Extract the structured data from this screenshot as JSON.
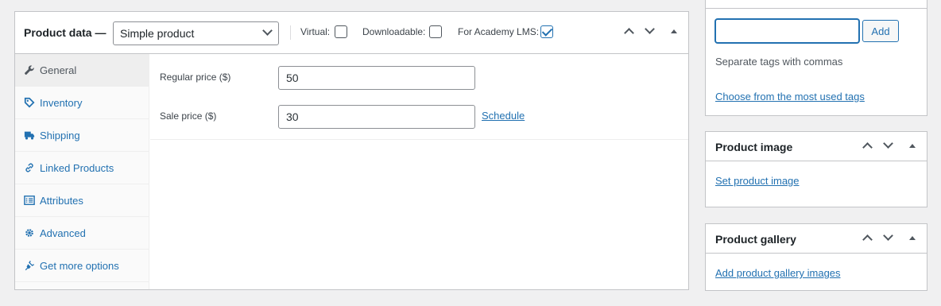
{
  "product_data": {
    "title": "Product data —",
    "type_select": "Simple product",
    "options": [
      {
        "label": "Virtual:",
        "checked": false
      },
      {
        "label": "Downloadable:",
        "checked": false
      },
      {
        "label": "For Academy LMS:",
        "checked": true
      }
    ],
    "tabs": [
      {
        "label": "General",
        "icon": "wrench-icon",
        "active": true
      },
      {
        "label": "Inventory",
        "icon": "tag-icon",
        "active": false
      },
      {
        "label": "Shipping",
        "icon": "truck-icon",
        "active": false
      },
      {
        "label": "Linked Products",
        "icon": "link-icon",
        "active": false
      },
      {
        "label": "Attributes",
        "icon": "list-icon",
        "active": false
      },
      {
        "label": "Advanced",
        "icon": "gear-icon",
        "active": false
      },
      {
        "label": "Get more options",
        "icon": "plugin-icon",
        "active": false
      }
    ],
    "general": {
      "regular_price_label": "Regular price ($)",
      "regular_price_value": "50",
      "sale_price_label": "Sale price ($)",
      "sale_price_value": "30",
      "schedule_link": "Schedule"
    }
  },
  "tags_box": {
    "input_value": "",
    "add_button": "Add",
    "help_text": "Separate tags with commas",
    "choose_link": "Choose from the most used tags"
  },
  "product_image_box": {
    "title": "Product image",
    "link": "Set product image"
  },
  "product_gallery_box": {
    "title": "Product gallery",
    "link": "Add product gallery images"
  },
  "colors": {
    "accent": "#2271b1",
    "background": "#f0f0f1",
    "border": "#c3c4c7"
  }
}
